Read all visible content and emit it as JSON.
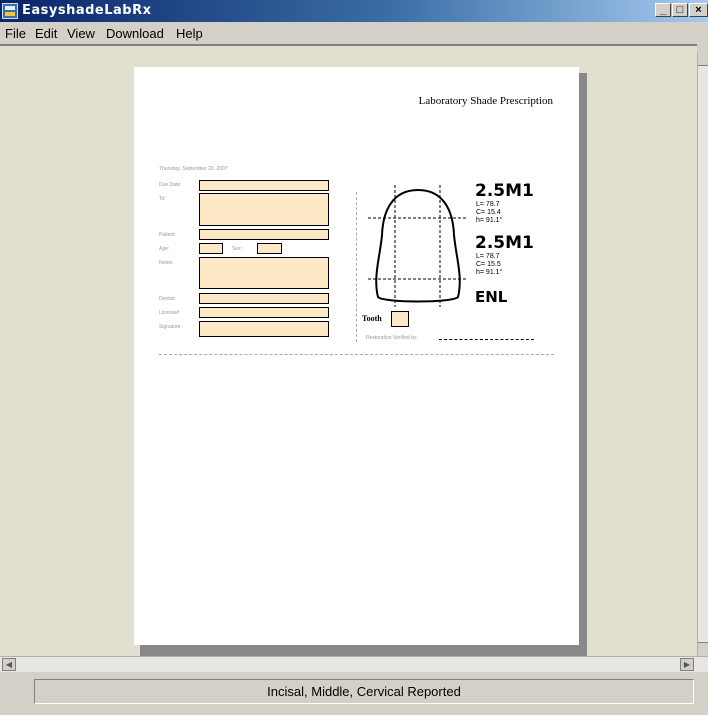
{
  "window": {
    "title": "EasyshadeLabRx",
    "icon": "app-icon"
  },
  "menu": [
    "File",
    "Edit",
    "View",
    "Download",
    "Help"
  ],
  "document": {
    "heading": "Laboratory Shade Prescription",
    "date": "Thursday, September 20, 2007",
    "fields": {
      "due_date": "Due Date:",
      "to": "To:",
      "patient": "Patient:",
      "age": "Age:",
      "sex": "Sex:",
      "notes": "Notes:",
      "dentist": "Dentist:",
      "license": "License#:",
      "signature": "Signature:"
    },
    "shade1": {
      "name": "2.5M1",
      "L": "L= 78.7",
      "C": "C= 15.4",
      "h": "h= 91.1°"
    },
    "shade2": {
      "name": "2.5M1",
      "L": "L= 78.7",
      "C": "C= 15.5",
      "h": "h= 91.1°"
    },
    "shade3": "ENL",
    "tooth_label": "Tooth",
    "verified_label": "Restoration Verified by:"
  },
  "status": {
    "text": "Incisal, Middle, Cervical Reported"
  },
  "colors": {
    "titlebar": "#0a246a",
    "field_fill": "#fde9c5",
    "workspace": "#e0dfd0"
  }
}
